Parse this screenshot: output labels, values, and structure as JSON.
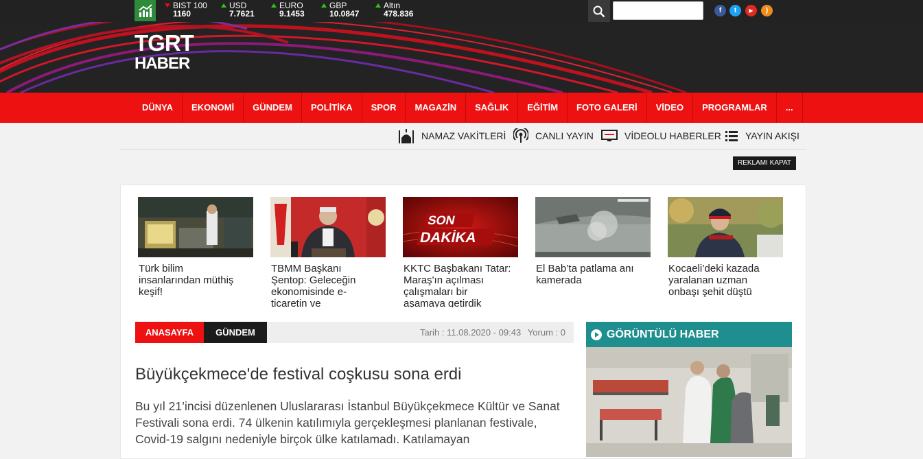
{
  "tickers": [
    {
      "name": "BIST 100",
      "value": "1160",
      "trend": "down"
    },
    {
      "name": "USD",
      "value": "7.7621",
      "trend": "up"
    },
    {
      "name": "EURO",
      "value": "9.1453",
      "trend": "up"
    },
    {
      "name": "GBP",
      "value": "10.0847",
      "trend": "up"
    },
    {
      "name": "Altın",
      "value": "478.836",
      "trend": "up"
    }
  ],
  "social": [
    {
      "icon": "facebook-icon",
      "glyph": "f",
      "color": "#3b5998"
    },
    {
      "icon": "twitter-icon",
      "glyph": "t",
      "color": "#1da1f2"
    },
    {
      "icon": "youtube-icon",
      "glyph": "▶",
      "color": "#e02a20"
    },
    {
      "icon": "rss-icon",
      "glyph": ")",
      "color": "#f08c1e"
    }
  ],
  "logo": {
    "line1": "TGRT",
    "line2": "HABER"
  },
  "nav": [
    "DÜNYA",
    "EKONOMİ",
    "GÜNDEM",
    "POLİTİKA",
    "SPOR",
    "MAGAZİN",
    "SAĞLIK",
    "EĞİTİM",
    "FOTO GALERİ",
    "VİDEO",
    "PROGRAMLAR",
    "..."
  ],
  "subnav": {
    "prayer": "NAMAZ VAKİTLERİ",
    "live": "CANLI YAYIN",
    "video_news": "VİDEOLU HABERLER",
    "schedule": "YAYIN AKIŞI"
  },
  "ad_close": "REKLAMI KAPAT",
  "news_cards": [
    {
      "title": "Türk bilim insanlarından müthiş keşif!"
    },
    {
      "title": "TBMM Başkanı Şentop: Geleceğin ekonomisinde e-ticaretin ve"
    },
    {
      "title": "KKTC Başbakanı Tatar: Maraş'ın açılması çalışmaları bir aşamaya getirdik",
      "thumb_text": [
        "SON",
        "DAKİKA"
      ]
    },
    {
      "title": "El Bab’ta patlama anı kamerada"
    },
    {
      "title": "Kocaeli’deki kazada yaralanan uzman onbaşı şehit düştü"
    }
  ],
  "breadcrumb": {
    "home": "ANASAYFA",
    "category": "GÜNDEM",
    "date": "Tarih : 11.08.2020 - 09:43",
    "comments": "Yorum :  0"
  },
  "article": {
    "headline": "Büyükçekmece'de festival coşkusu sona erdi",
    "lead": "Bu yıl 21’incisi düzenlenen Uluslararası İstanbul Büyükçekmece Kültür ve Sanat Festivali sona erdi. 74 ülkenin katılımıyla gerçekleşmesi planlanan festivale, Covid-19 salgını nedeniyle birçok ülke katılamadı. Katılamayan"
  },
  "video_widget": {
    "title": "GÖRÜNTÜLÜ HABER"
  }
}
